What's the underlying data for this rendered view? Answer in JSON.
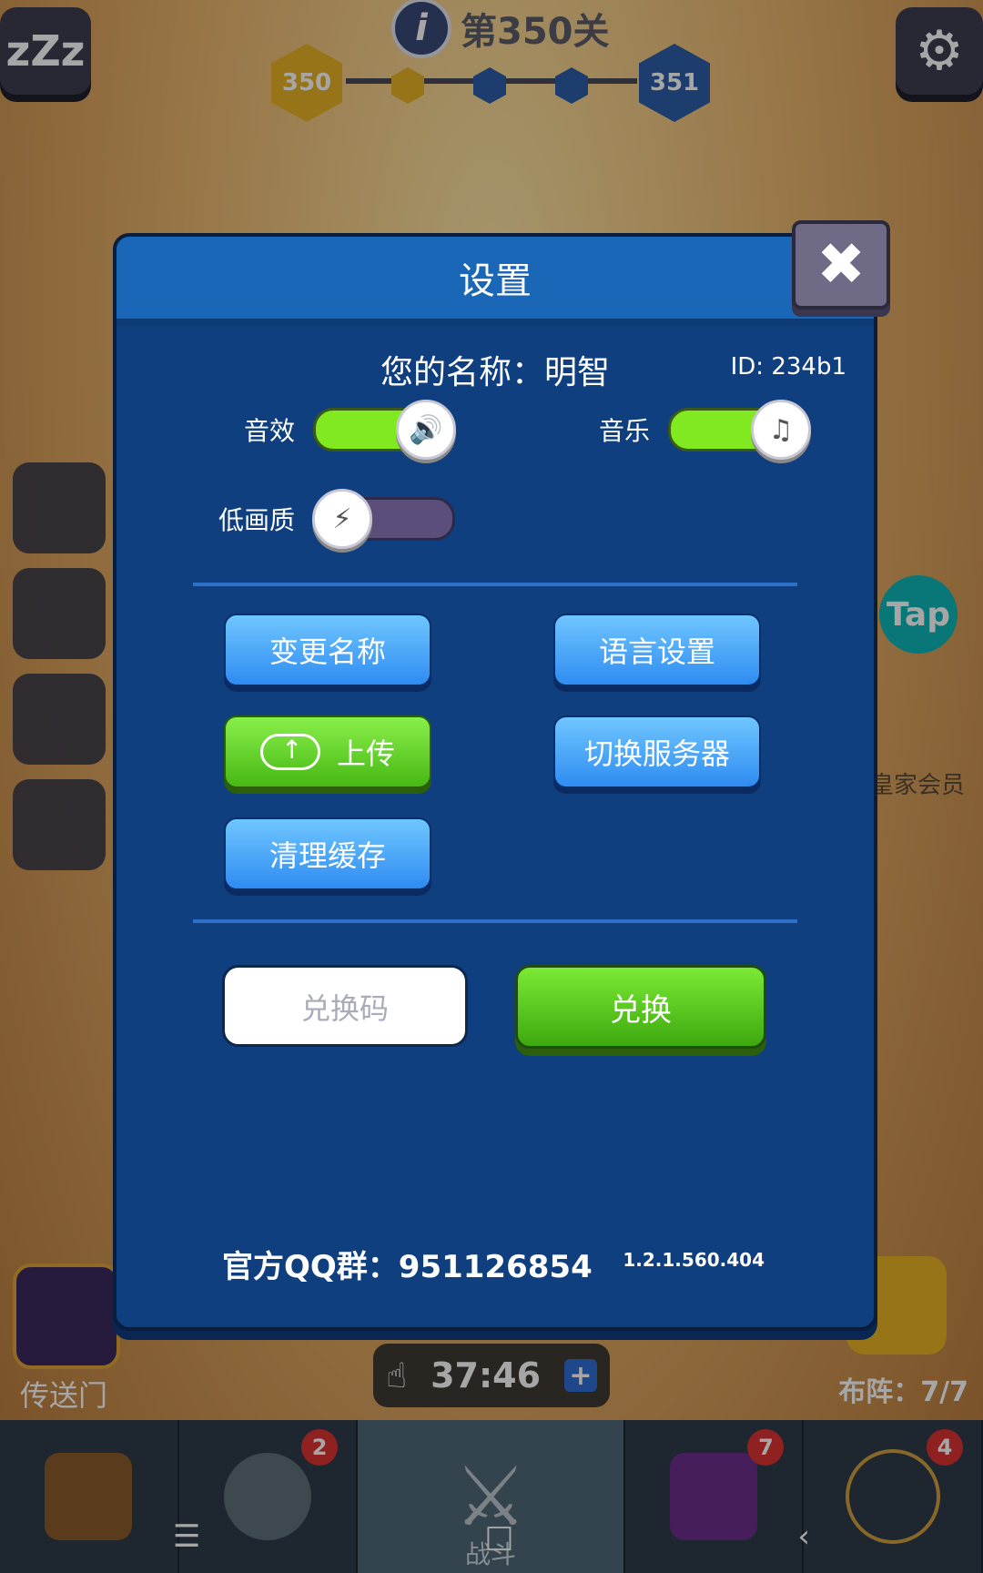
{
  "hud": {
    "sleep_glyph": "zZz",
    "level_title": "第350关",
    "current_level": "350",
    "next_level": "351",
    "settings_icon": "gear-icon",
    "info_icon": "info-icon"
  },
  "right_panel": {
    "tap_label": "Tap",
    "vip_label": "皇家会员",
    "formation_label": "布阵：7/7"
  },
  "left_panel": {
    "portal_label": "传送门"
  },
  "timer": {
    "time": "37:46",
    "plus": "+"
  },
  "bottom_nav": {
    "badge_hero": "2",
    "battle_label": "战斗",
    "badge_book": "7",
    "badge_amulet": "4"
  },
  "android_nav": {
    "menu": "☰",
    "home": "□",
    "back": "‹"
  },
  "dialog": {
    "title": "设置",
    "close": "✖",
    "name_label": "您的名称：明智",
    "id_text": "ID:  234b1",
    "sound_label": "音效",
    "music_label": "音乐",
    "low_quality_label": "低画质",
    "sound_enabled": true,
    "music_enabled": true,
    "low_quality_enabled": false,
    "change_name": "变更名称",
    "language_settings": "语言设置",
    "upload": "上传",
    "switch_server": "切换服务器",
    "clear_cache": "清理缓存",
    "redeem_placeholder": "兑换码",
    "redeem_button": "兑换",
    "qq_group": "官方QQ群：951126854",
    "version": "1.2.1.560.404"
  }
}
